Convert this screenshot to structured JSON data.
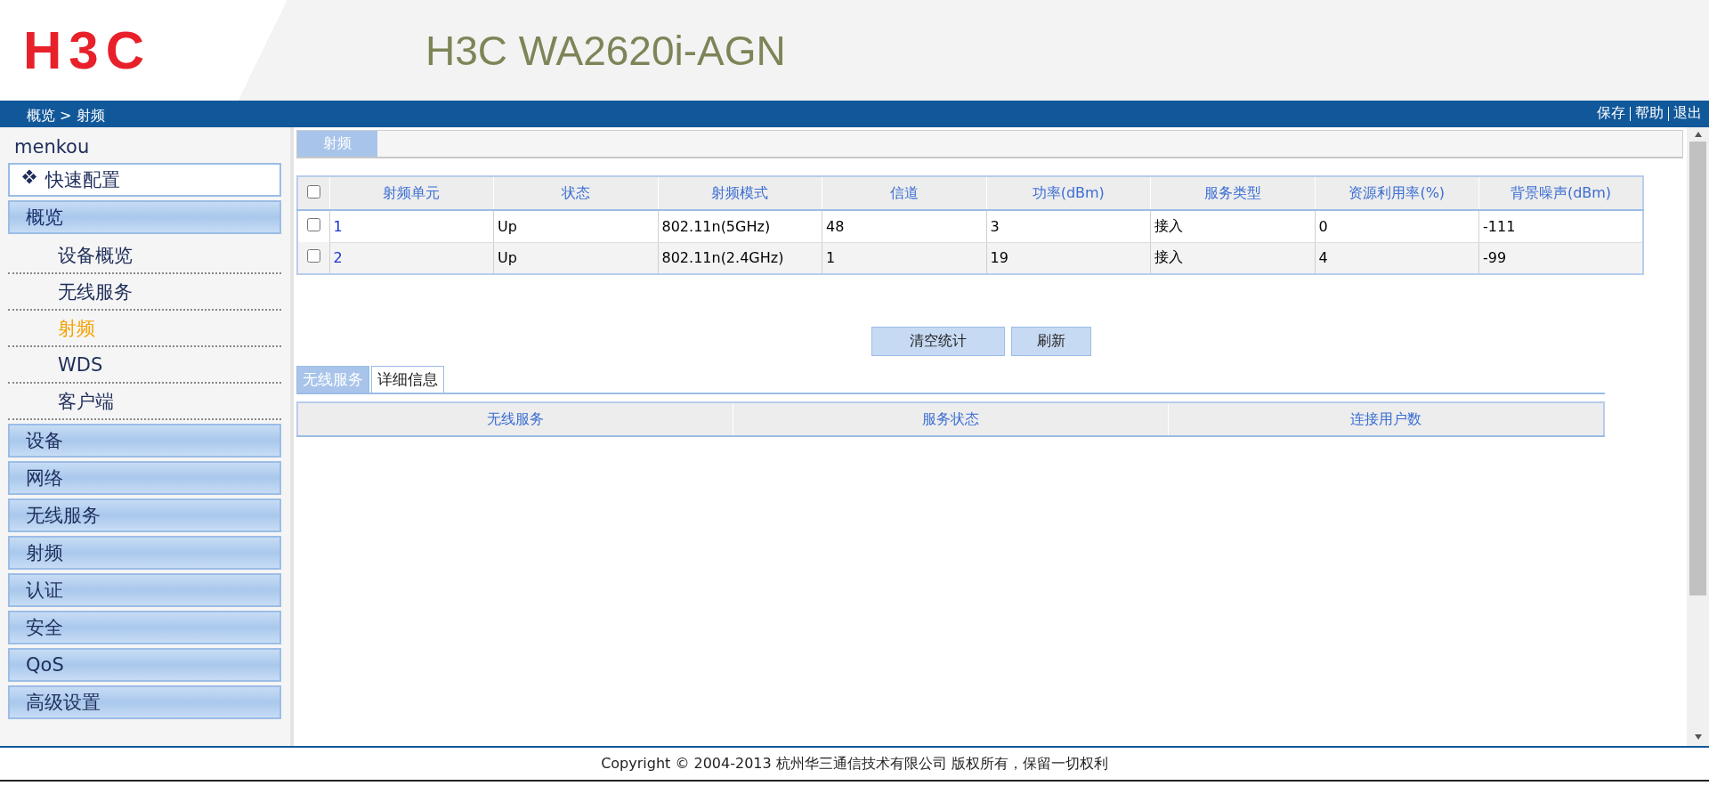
{
  "header": {
    "logo": "H3C",
    "title": "H3C WA2620i-AGN"
  },
  "breadcrumb": "概览 > 射频",
  "top_links": [
    "保存",
    "帮助",
    "退出"
  ],
  "sidebar": {
    "user": "menkou",
    "items": [
      {
        "kind": "quick",
        "label": "快速配置"
      },
      {
        "kind": "group",
        "label": "概览",
        "expanded": true,
        "children": [
          {
            "label": "设备概览",
            "selected": false
          },
          {
            "label": "无线服务",
            "selected": false
          },
          {
            "label": "射频",
            "selected": true
          },
          {
            "label": "WDS",
            "selected": false
          },
          {
            "label": "客户端",
            "selected": false
          }
        ]
      },
      {
        "kind": "group",
        "label": "设备",
        "expanded": false
      },
      {
        "kind": "group",
        "label": "网络",
        "expanded": false
      },
      {
        "kind": "group",
        "label": "无线服务",
        "expanded": false
      },
      {
        "kind": "group",
        "label": "射频",
        "expanded": false
      },
      {
        "kind": "group",
        "label": "认证",
        "expanded": false
      },
      {
        "kind": "group",
        "label": "安全",
        "expanded": false
      },
      {
        "kind": "group",
        "label": "QoS",
        "expanded": false
      },
      {
        "kind": "group",
        "label": "高级设置",
        "expanded": false
      }
    ]
  },
  "page_tab": "射频",
  "table": {
    "select_all": false,
    "columns": [
      "射频单元",
      "状态",
      "射频模式",
      "信道",
      "功率(dBm)",
      "服务类型",
      "资源利用率(%)",
      "背景噪声(dBm)"
    ],
    "rows": [
      {
        "checked": false,
        "cells": [
          "1",
          "Up",
          "802.11n(5GHz)",
          "48",
          "3",
          "接入",
          "0",
          "-111"
        ]
      },
      {
        "checked": false,
        "cells": [
          "2",
          "Up",
          "802.11n(2.4GHz)",
          "1",
          "19",
          "接入",
          "4",
          "-99"
        ]
      }
    ]
  },
  "buttons": [
    "清空统计",
    "刷新"
  ],
  "detail_tabs": [
    {
      "label": "无线服务",
      "selected": true
    },
    {
      "label": "详细信息",
      "selected": false
    }
  ],
  "detail_table": {
    "columns": [
      "无线服务",
      "服务状态",
      "连接用户数"
    ]
  },
  "footer": "Copyright © 2004-2013 杭州华三通信技术有限公司 版权所有，保留一切权利"
}
